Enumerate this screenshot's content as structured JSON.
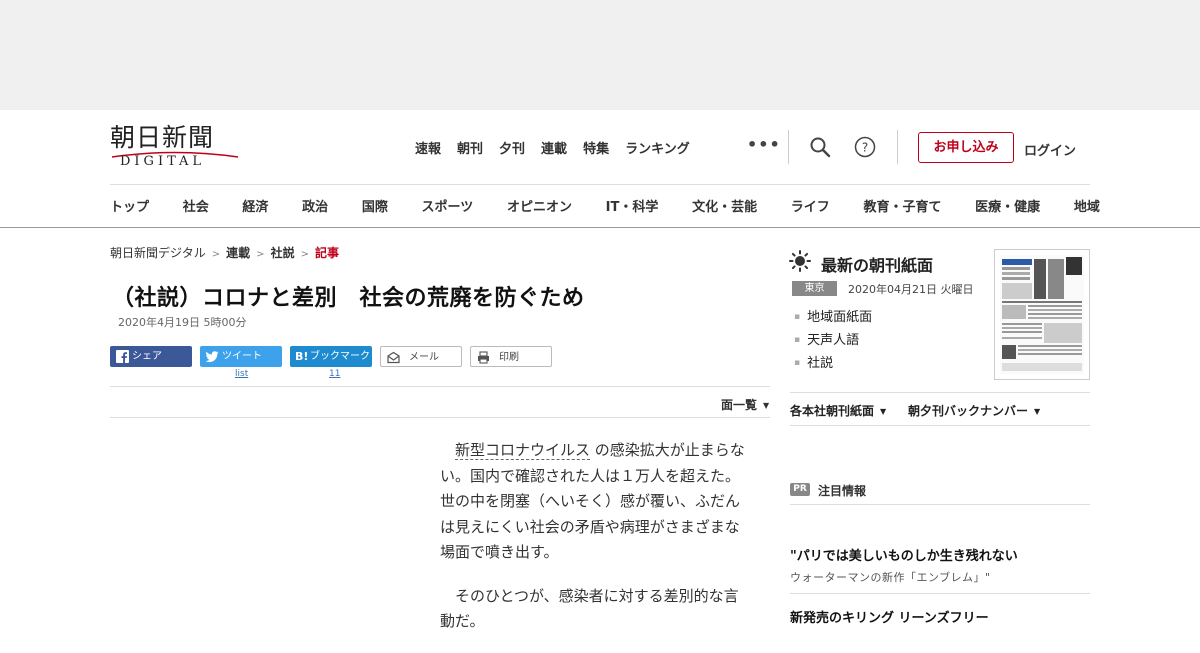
{
  "header": {
    "logo_main": "朝日新聞",
    "logo_sub": "DIGITAL",
    "top_nav": [
      "速報",
      "朝刊",
      "夕刊",
      "連載",
      "特集",
      "ランキング"
    ],
    "more_label": "•••",
    "subscribe_label": "お申し込み",
    "login_label": "ログイン",
    "categories": [
      "トップ",
      "社会",
      "経済",
      "政治",
      "国際",
      "スポーツ",
      "オピニオン",
      "IT・科学",
      "文化・芸能",
      "ライフ",
      "教育・子育て",
      "医療・健康",
      "地域"
    ]
  },
  "breadcrumb": {
    "items": [
      "朝日新聞デジタル",
      "連載",
      "社説"
    ],
    "current": "記事",
    "separator": ">"
  },
  "article": {
    "title": "（社説）コロナと差別　社会の荒廃を防ぐため",
    "date": "2020年4月19日 5時00分",
    "share": {
      "facebook": "シェア",
      "twitter": "ツイート",
      "twitter_sub": "list",
      "hatena": "ブックマーク",
      "hatena_prefix": "B!",
      "hatena_count": "11",
      "mail": "メール",
      "print": "印刷"
    },
    "page_list_label": "面一覧",
    "keyword": "新型コロナウイルス",
    "p1_rest": "の感染拡大が止まらない。国内で確認された人は１万人を超えた。世の中を閉塞（へいそく）感が覆い、ふだんは見えにくい社会の矛盾や病理がさまざまな場面で噴き出す。",
    "p2": "そのひとつが、感染者に対する差別的な言動だ。"
  },
  "sidebar": {
    "title": "最新の朝刊紙面",
    "region": "東京",
    "date": "2020年04月21日 火曜日",
    "links": [
      "地域面紙面",
      "天声人語",
      "社説"
    ],
    "dropdown1": "各本社朝刊紙面",
    "dropdown2": "朝夕刊バックナンバー",
    "pr_badge": "PR",
    "pr_label": "注目情報",
    "promo1_title": "\"パリでは美しいものしか生き残れない",
    "promo1_sub": "ウォーターマンの新作「エンブレム」\"",
    "promo2_title": "新発売のキリング リーンズフリー"
  },
  "colors": {
    "accent_red": "#c0001a",
    "facebook": "#3b5998",
    "twitter": "#3ea1ec",
    "hatena": "#1e8ad0"
  }
}
